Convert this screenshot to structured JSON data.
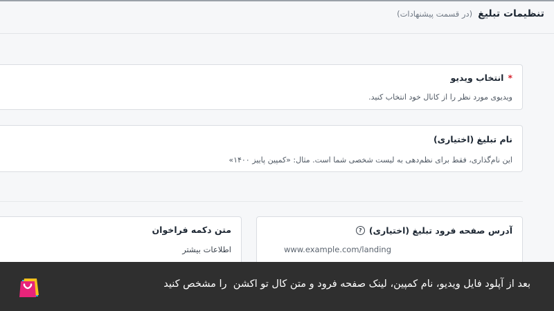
{
  "header": {
    "title": "تنظیمات تبلیغ",
    "subtitle": "(در قسمت پیشنهادات)"
  },
  "video_field": {
    "required_mark": "*",
    "label": "انتخاب ویدیو",
    "description": "ویدیوی مورد نظر را از کانال خود انتخاب کنید."
  },
  "campaign_name_field": {
    "label": "نام تبلیغ (اختیاری)",
    "description": "این نام‌گذاری، فقط برای نظم‌دهی به لیست شخصی شما است. مثال: «کمپین پاییز ۱۴۰۰»"
  },
  "landing_url_field": {
    "label": "آدرس صفحه فرود تبلیغ (اختیاری)",
    "help_icon": "?",
    "placeholder": "www.example.com/landing"
  },
  "cta_field": {
    "label": "متن دکمه فراخوان",
    "value": "اطلاعات بیشتر"
  },
  "caption": {
    "text": "بعد از آپلود فایل ویدیو، نام کمپین، لینک صفحه فرود و متن کال تو اکشن  را مشخص کنید"
  },
  "colors": {
    "caption_bg": "#2f2f2f",
    "required": "#d6242f",
    "logo_pink": "#e8247a",
    "logo_yellow": "#f6c21c",
    "logo_cyan": "#27b7e6"
  }
}
